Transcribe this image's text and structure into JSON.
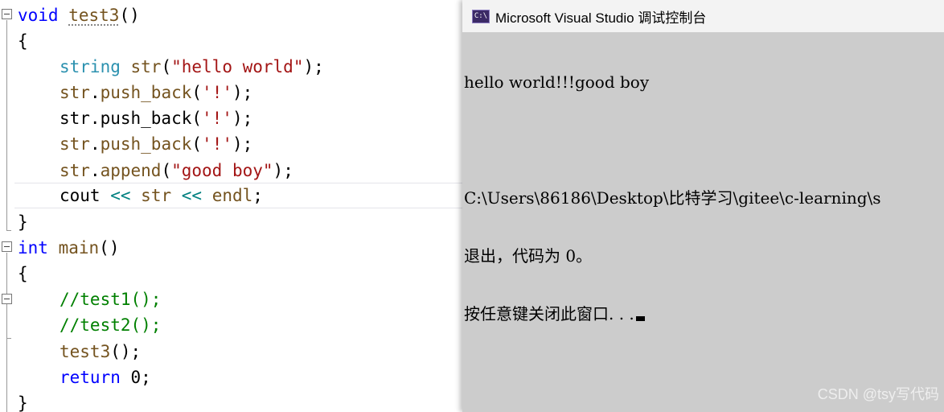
{
  "editor": {
    "lines": [
      {
        "tokens": [
          [
            "kw",
            "void"
          ],
          [
            "plain",
            " "
          ],
          [
            "fn",
            "test3"
          ],
          [
            "plain",
            "()"
          ]
        ]
      },
      {
        "tokens": [
          [
            "plain",
            "{"
          ]
        ]
      },
      {
        "tokens": [
          [
            "typ",
            "string"
          ],
          [
            "plain",
            " "
          ],
          [
            "fn",
            "str"
          ],
          [
            "plain",
            "("
          ],
          [
            "str",
            "\"hello world\""
          ],
          [
            "plain",
            ");"
          ]
        ]
      },
      {
        "tokens": [
          [
            "fn",
            "str"
          ],
          [
            "plain",
            "."
          ],
          [
            "fn",
            "push_back"
          ],
          [
            "plain",
            "("
          ],
          [
            "str",
            "'!'"
          ],
          [
            "plain",
            ");"
          ]
        ]
      },
      {
        "tokens": [
          [
            "plain",
            "str.push_back("
          ],
          [
            "str",
            "'!'"
          ],
          [
            "plain",
            ");"
          ]
        ]
      },
      {
        "tokens": [
          [
            "fn",
            "str"
          ],
          [
            "plain",
            "."
          ],
          [
            "fn",
            "push_back"
          ],
          [
            "plain",
            "("
          ],
          [
            "str",
            "'!'"
          ],
          [
            "plain",
            ");"
          ]
        ]
      },
      {
        "tokens": [
          [
            "fn",
            "str"
          ],
          [
            "plain",
            "."
          ],
          [
            "fn",
            "append"
          ],
          [
            "plain",
            "("
          ],
          [
            "str",
            "\"good boy\""
          ],
          [
            "plain",
            ");"
          ]
        ]
      },
      {
        "tokens": [
          [
            "plain",
            "cout "
          ],
          [
            "op",
            "<<"
          ],
          [
            "plain",
            " "
          ],
          [
            "fn",
            "str"
          ],
          [
            "plain",
            " "
          ],
          [
            "op",
            "<<"
          ],
          [
            "plain",
            " "
          ],
          [
            "fn",
            "endl"
          ],
          [
            "plain",
            ";"
          ]
        ]
      },
      {
        "tokens": [
          [
            "plain",
            "}"
          ]
        ]
      },
      {
        "tokens": [
          [
            "kw",
            "int"
          ],
          [
            "plain",
            " "
          ],
          [
            "fn",
            "main"
          ],
          [
            "plain",
            "()"
          ]
        ]
      },
      {
        "tokens": [
          [
            "plain",
            "{"
          ]
        ]
      },
      {
        "tokens": [
          [
            "cmt",
            "//test1();"
          ]
        ]
      },
      {
        "tokens": [
          [
            "cmt",
            "//test2();"
          ]
        ]
      },
      {
        "tokens": [
          [
            "fn",
            "test3"
          ],
          [
            "plain",
            "();"
          ]
        ]
      },
      {
        "tokens": [
          [
            "kw",
            "return"
          ],
          [
            "plain",
            " 0;"
          ]
        ]
      },
      {
        "tokens": [
          [
            "plain",
            "}"
          ]
        ]
      }
    ]
  },
  "console": {
    "icon_label": "C:\\",
    "title": "Microsoft Visual Studio 调试控制台",
    "output_lines": [
      "hello world!!!good boy",
      "",
      "C:\\Users\\86186\\Desktop\\比特学习\\gitee\\c-learning\\s",
      "退出，代码为 0。",
      "按任意键关闭此窗口. . ."
    ]
  },
  "watermark": "CSDN @tsy写代码",
  "colors": {
    "keyword": "#0000ff",
    "type": "#2b91af",
    "function": "#74531f",
    "string": "#a31515",
    "comment": "#008000",
    "operator": "#008080",
    "console_bg": "#cccccc"
  }
}
